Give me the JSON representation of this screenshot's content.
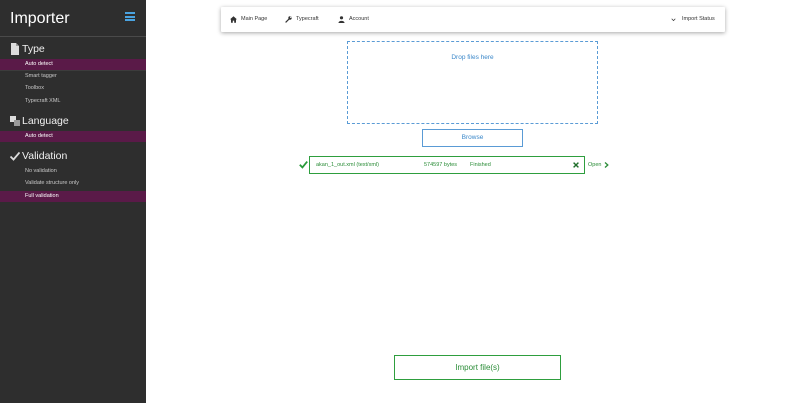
{
  "sidebar": {
    "title": "Importer",
    "sections": [
      {
        "icon": "document-icon",
        "label": "Type",
        "items": [
          {
            "label": "Auto detect",
            "active": true
          },
          {
            "label": "Smart tagger",
            "active": false
          },
          {
            "label": "Toolbox",
            "active": false
          },
          {
            "label": "Typecraft XML",
            "active": false
          }
        ]
      },
      {
        "icon": "language-icon",
        "label": "Language",
        "items": [
          {
            "label": "Auto detect",
            "active": true
          }
        ]
      },
      {
        "icon": "checkmark-icon",
        "label": "Validation",
        "items": [
          {
            "label": "No validation",
            "active": false
          },
          {
            "label": "Validate structure only",
            "active": false
          },
          {
            "label": "Full validation",
            "active": true
          }
        ]
      }
    ]
  },
  "nav": {
    "main_page": "Main Page",
    "typecraft": "Typecraft",
    "account": "Account",
    "import_status": "Import Status"
  },
  "dropzone": {
    "text": "Drop files here"
  },
  "browse_label": "Browse",
  "file": {
    "name": "akan_1_out.xml (text/xml)",
    "size": "574597 bytes",
    "status": "Finished",
    "open_label": "Open"
  },
  "import_label": "Import file(s)",
  "colors": {
    "sidebar_bg": "#2e2e2e",
    "active_item": "#5a1a48",
    "accent_blue": "#3a87c9",
    "success_green": "#2a8c37"
  }
}
